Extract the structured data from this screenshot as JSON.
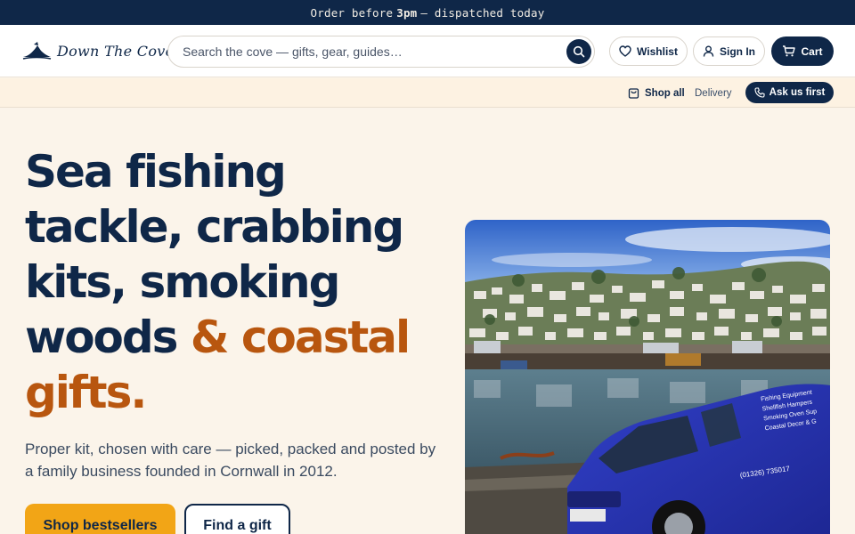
{
  "announcement": {
    "pre": "Order before",
    "time": "3pm",
    "post": "— dispatched today"
  },
  "brand": {
    "name": "Down The Cove",
    "logo_icon": "boat-logo-icon"
  },
  "search": {
    "placeholder": "Search the cove — gifts, gear, guides…"
  },
  "header_actions": {
    "wishlist": "Wishlist",
    "signin": "Sign In",
    "cart": "Cart"
  },
  "subnav": {
    "shop_all": "Shop all",
    "delivery": "Delivery",
    "ask_us": "Ask us first"
  },
  "hero": {
    "title_main": "Sea fishing tackle, crabbing kits, smoking woods ",
    "title_accent": "& coastal gifts.",
    "subtitle": "Proper kit, chosen with care — picked, packed and posted by a family business founded in Cornwall in 2012.",
    "cta_primary": "Shop bestsellers",
    "cta_secondary": "Find a gift",
    "van_text": [
      "Fishing Equipment",
      "Shellfish Hampers",
      "Smoking Oven Sup",
      "Coastal Decor & G"
    ],
    "van_phone": "(01326) 735017"
  },
  "colors": {
    "navy": "#0f2748",
    "accent": "#b8560f",
    "cta": "#f2a516",
    "background": "#fbf4ea"
  }
}
